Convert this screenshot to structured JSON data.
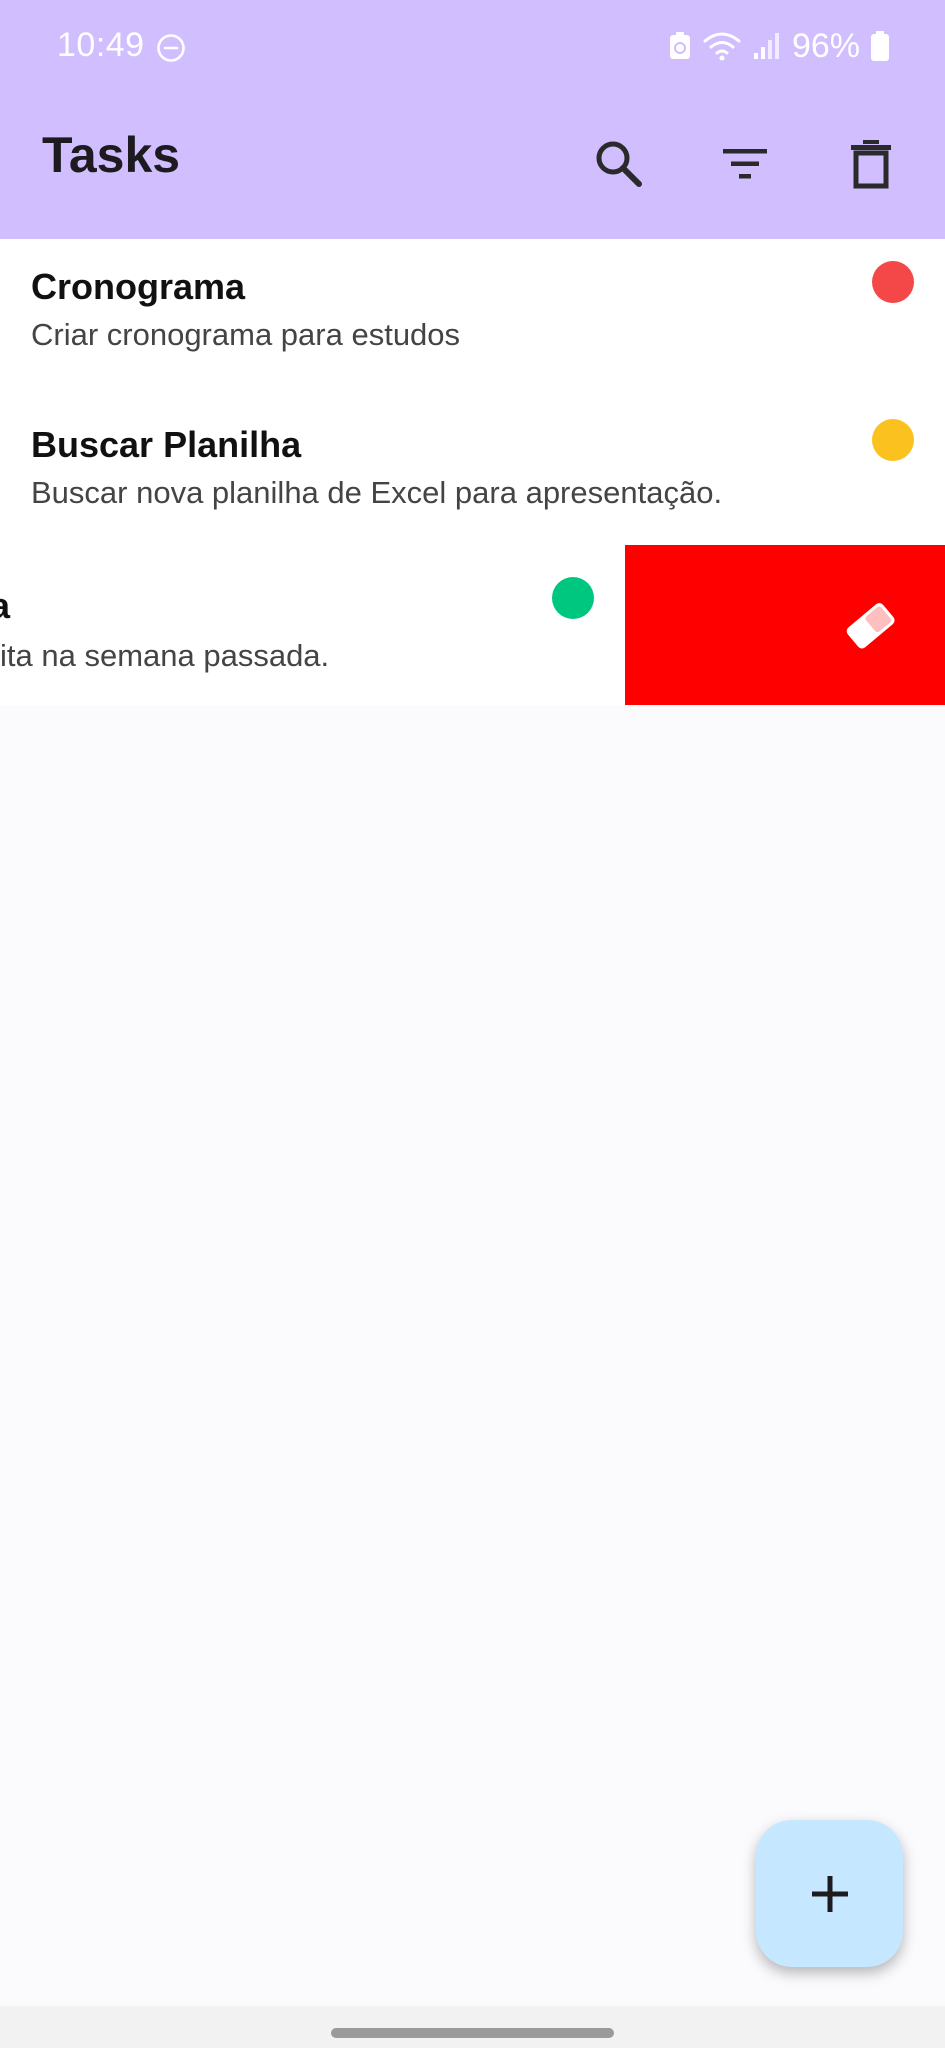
{
  "status_bar": {
    "time": "10:49",
    "battery": "96%",
    "icons": [
      "do-not-disturb-icon",
      "battery-saver-icon",
      "wifi-icon",
      "signal-icon",
      "battery-icon"
    ]
  },
  "app_bar": {
    "title": "Tasks",
    "actions": [
      "search-icon",
      "filter-icon",
      "delete-all-icon"
    ]
  },
  "tasks": [
    {
      "title": "Cronograma",
      "description": "Criar cronograma para estudos",
      "priority_color": "#f44747"
    },
    {
      "title": "Buscar Planilha",
      "description": "Buscar nova planilha de Excel para apresentação.",
      "priority_color": "#fbc21f"
    },
    {
      "title_fragment": "a",
      "description_fragment": "ita na semana passada.",
      "priority_color": "#00c77f"
    }
  ],
  "swipe_action": {
    "color": "#ff0000",
    "icon": "eraser-icon"
  },
  "fab": {
    "icon": "add-icon",
    "color": "#c5e7ff"
  },
  "colors": {
    "app_bar": "#d0beff",
    "background": "#fbfbfe"
  }
}
